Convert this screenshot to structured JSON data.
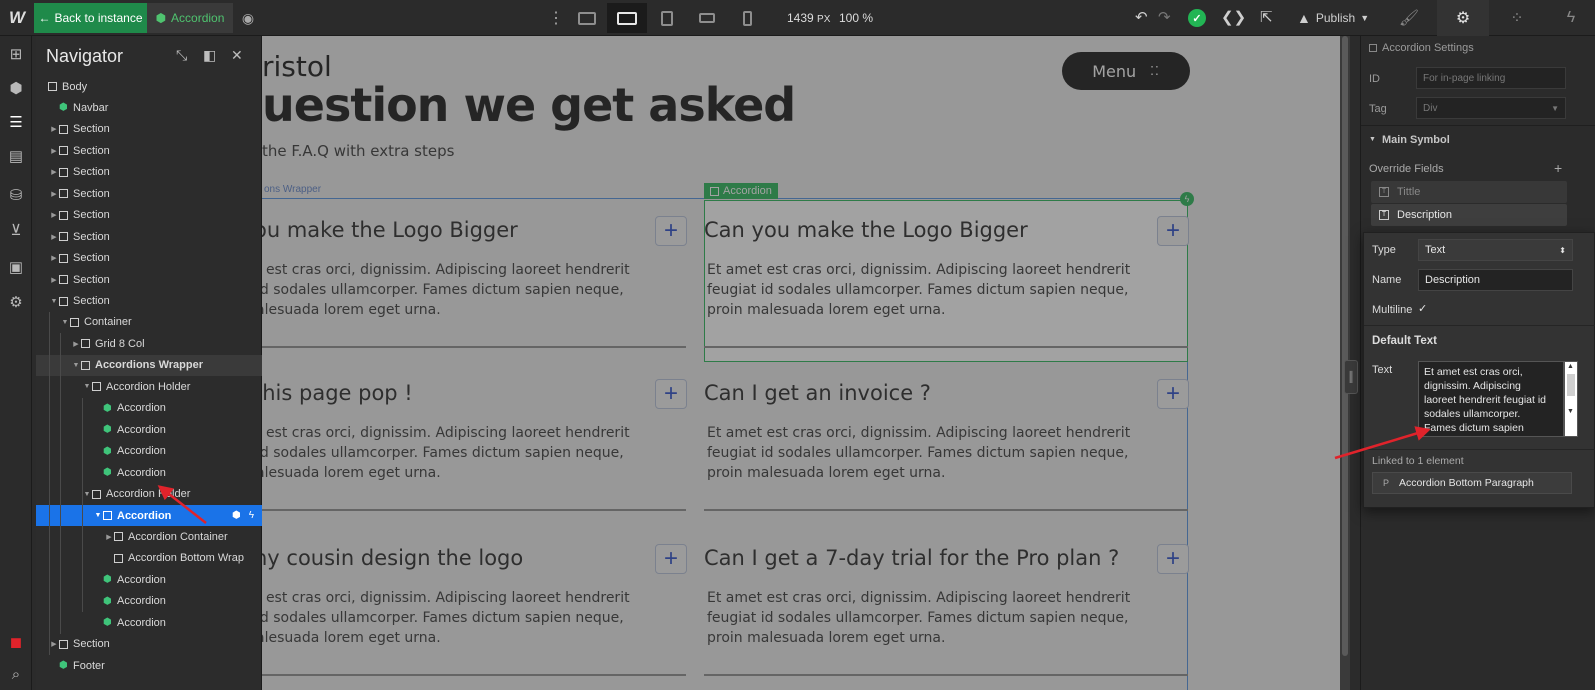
{
  "topbar": {
    "logo": "W",
    "back_label": "Back to instance",
    "instance_label": "Accordion",
    "width_value": "1439",
    "width_unit": "PX",
    "zoom": "100 %",
    "publish_label": "Publish"
  },
  "navigator": {
    "title": "Navigator",
    "rows": [
      {
        "label": "Body",
        "indent": 0,
        "caret": false,
        "icon": "box"
      },
      {
        "label": "Navbar",
        "indent": 1,
        "caret": false,
        "icon": "symbol"
      },
      {
        "label": "Section",
        "indent": 1,
        "caret": "right",
        "icon": "box"
      },
      {
        "label": "Section",
        "indent": 1,
        "caret": "right",
        "icon": "box"
      },
      {
        "label": "Section",
        "indent": 1,
        "caret": "right",
        "icon": "box"
      },
      {
        "label": "Section",
        "indent": 1,
        "caret": "right",
        "icon": "box"
      },
      {
        "label": "Section",
        "indent": 1,
        "caret": "right",
        "icon": "box"
      },
      {
        "label": "Section",
        "indent": 1,
        "caret": "right",
        "icon": "box"
      },
      {
        "label": "Section",
        "indent": 1,
        "caret": "right",
        "icon": "box"
      },
      {
        "label": "Section",
        "indent": 1,
        "caret": "right",
        "icon": "box"
      },
      {
        "label": "Section",
        "indent": 1,
        "caret": "down",
        "icon": "box"
      },
      {
        "label": "Container",
        "indent": 2,
        "caret": "down",
        "icon": "box"
      },
      {
        "label": "Grid 8 Col",
        "indent": 3,
        "caret": "right",
        "icon": "box"
      },
      {
        "label": "Accordions Wrapper",
        "indent": 3,
        "caret": "down",
        "icon": "box",
        "state": "hl"
      },
      {
        "label": "Accordion Holder",
        "indent": 4,
        "caret": "down",
        "icon": "box"
      },
      {
        "label": "Accordion",
        "indent": 5,
        "caret": false,
        "icon": "symbol"
      },
      {
        "label": "Accordion",
        "indent": 5,
        "caret": false,
        "icon": "symbol"
      },
      {
        "label": "Accordion",
        "indent": 5,
        "caret": false,
        "icon": "symbol"
      },
      {
        "label": "Accordion",
        "indent": 5,
        "caret": false,
        "icon": "symbol"
      },
      {
        "label": "Accordion Holder",
        "indent": 4,
        "caret": "down",
        "icon": "box"
      },
      {
        "label": "Accordion",
        "indent": 5,
        "caret": "down",
        "icon": "box",
        "state": "sel"
      },
      {
        "label": "Accordion Container",
        "indent": 6,
        "caret": "right",
        "icon": "box"
      },
      {
        "label": "Accordion Bottom Wrap",
        "indent": 6,
        "caret": false,
        "icon": "box"
      },
      {
        "label": "Accordion",
        "indent": 5,
        "caret": false,
        "icon": "symbol"
      },
      {
        "label": "Accordion",
        "indent": 5,
        "caret": false,
        "icon": "symbol"
      },
      {
        "label": "Accordion",
        "indent": 5,
        "caret": false,
        "icon": "symbol"
      },
      {
        "label": "Section",
        "indent": 1,
        "caret": "right",
        "icon": "box"
      },
      {
        "label": "Footer",
        "indent": 1,
        "caret": false,
        "icon": "symbol"
      }
    ]
  },
  "canvas": {
    "brand_fragment": "ristol",
    "heading_fragment": "uestion we get asked",
    "subheading_fragment": "the F.A.Q with extra steps",
    "menu_label": "Menu",
    "wrapper_tag": "ons Wrapper",
    "selected_tag": "Accordion",
    "left_column": [
      {
        "question": "ou make the Logo Bigger",
        "answer_lines": [
          "t est cras orci, dignissim. Adipiscing laoreet hendrerit",
          "id sodales ullamcorper. Fames dictum sapien neque,",
          "alesuada lorem eget urna."
        ]
      },
      {
        "question": "this page pop !",
        "answer_lines": [
          "t est cras orci, dignissim. Adipiscing laoreet hendrerit",
          "id sodales ullamcorper. Fames dictum sapien neque,",
          "alesuada lorem eget urna."
        ]
      },
      {
        "question": "ny cousin design the logo",
        "answer_lines": [
          "t est cras orci, dignissim. Adipiscing laoreet hendrerit",
          "id sodales ullamcorper. Fames dictum sapien neque,",
          "alesuada lorem eget urna."
        ]
      }
    ],
    "right_column": [
      {
        "question": "Can you make the Logo Bigger",
        "answer_lines": [
          "Et amet est cras orci, dignissim. Adipiscing laoreet hendrerit",
          "feugiat id sodales ullamcorper. Fames dictum sapien neque,",
          "proin malesuada lorem eget urna."
        ]
      },
      {
        "question": "Can I get an invoice ?",
        "answer_lines": [
          "Et amet est cras orci, dignissim. Adipiscing laoreet hendrerit",
          "feugiat id sodales ullamcorper. Fames dictum sapien neque,",
          "proin malesuada lorem eget urna."
        ]
      },
      {
        "question": "Can I get a 7-day trial for the Pro plan ?",
        "answer_lines": [
          "Et amet est cras orci, dignissim. Adipiscing laoreet hendrerit",
          "feugiat id sodales ullamcorper. Fames dictum sapien neque,",
          "proin malesuada lorem eget urna."
        ]
      }
    ]
  },
  "settings": {
    "title": "Accordion Settings",
    "id_label": "ID",
    "id_placeholder": "For in-page linking",
    "tag_label": "Tag",
    "tag_value": "Div",
    "main_symbol": "Main Symbol",
    "override_fields": "Override Fields",
    "fields": [
      "Tittle",
      "Description"
    ]
  },
  "field_editor": {
    "type_label": "Type",
    "type_value": "Text",
    "name_label": "Name",
    "name_value": "Description",
    "multiline_label": "Multiline",
    "default_text_heading": "Default Text",
    "text_label": "Text",
    "text_lines": [
      "Et amet est cras orci,",
      "dignissim. Adipiscing",
      "laoreet hendrerit feugiat id",
      "sodales ullamcorper.",
      "Fames dictum sapien"
    ],
    "linked_label": "Linked to 1 element",
    "linked_element": "Accordion Bottom Paragraph",
    "linked_prefix": "P"
  },
  "colors": {
    "accent_green": "#22b554",
    "selection_blue": "#1a73e8",
    "annotation_red": "#e0232b"
  }
}
